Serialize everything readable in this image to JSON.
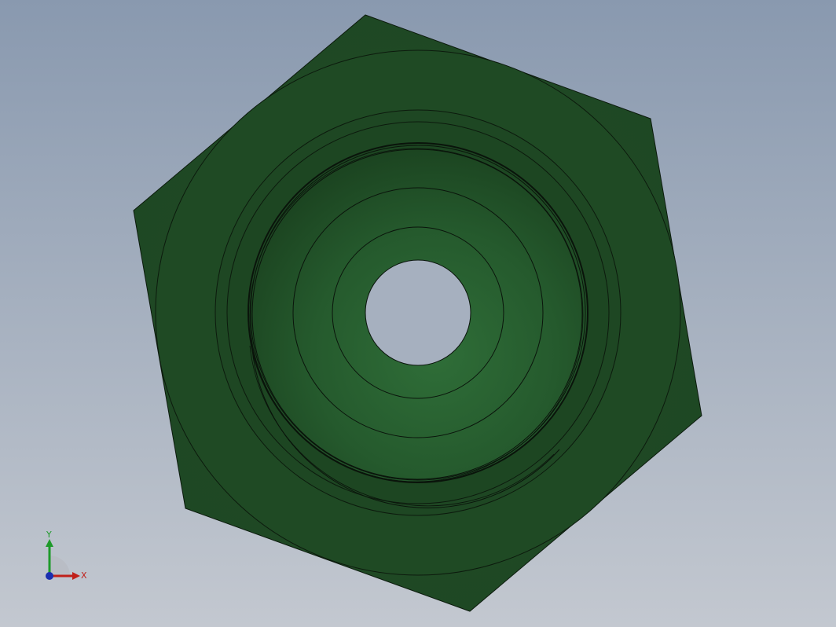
{
  "viewport": {
    "background_top": "#8a9bb0",
    "background_bottom": "#c2c7d0"
  },
  "model": {
    "name": "hex-nut-fitting",
    "face_color": "#1f4a24",
    "face_color_light": "#2d6a36",
    "edge_color": "#0a140b"
  },
  "triad": {
    "x_label": "X",
    "y_label": "Y",
    "x_color": "#c0201a",
    "y_color": "#1e9a2a",
    "z_color": "#1a2fb0"
  }
}
